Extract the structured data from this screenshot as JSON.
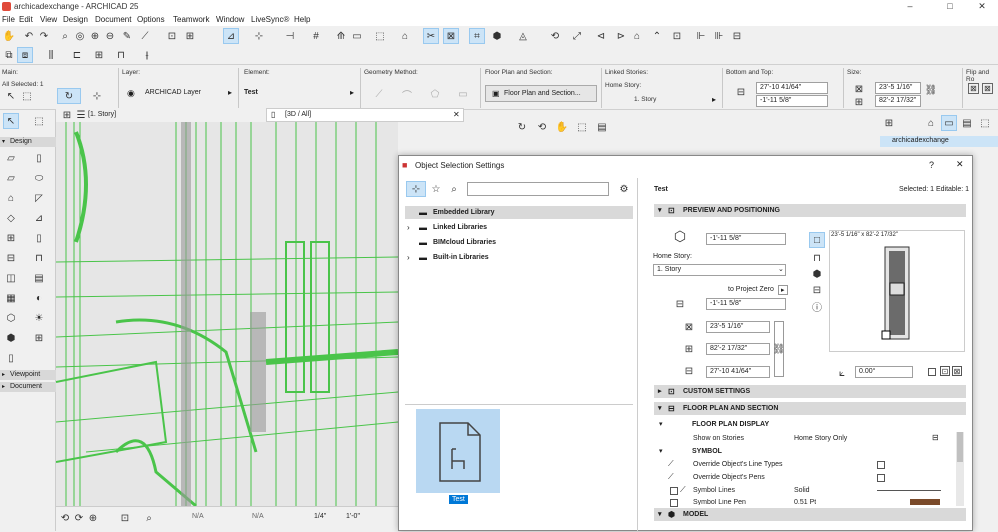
{
  "app": {
    "title": "archicadexchange - ARCHICAD 25"
  },
  "menu": [
    "File",
    "Edit",
    "View",
    "Design",
    "Document",
    "Options",
    "Teamwork",
    "Window",
    "LiveSync®",
    "Help"
  ],
  "info": {
    "main_label": "Main:",
    "selected": "All Selected: 1",
    "layer_label": "Layer:",
    "layer": "ARCHICAD Layer",
    "element_label": "Element:",
    "element": "Test",
    "geometry_label": "Geometry Method:",
    "fps_label": "Floor Plan and Section:",
    "fps": "Floor Plan and Section...",
    "linked_label": "Linked Stories:",
    "home_story_label": "Home Story:",
    "home_story": "1. Story",
    "bt_label": "Bottom and Top:",
    "bt_top": "27'-10 41/64\"",
    "bt_bottom": "-1'-11 5/8\"",
    "size_label": "Size:",
    "size_a": "23'-5 1/16\"",
    "size_b": "82'-2 17/32\"",
    "flip_label": "Flip and Ro"
  },
  "left": {
    "design": "Design",
    "viewpoint": "Viewpoint",
    "document": "Document"
  },
  "tabs": {
    "plan": "[1. Story]",
    "view3d": "[3D / All]"
  },
  "status": {
    "na1": "N/A",
    "na2": "N/A",
    "scale": "1/4\"",
    "dim": "1'-0\""
  },
  "right": {
    "name": "archicadexchange"
  },
  "dialog": {
    "title": "Object Selection Settings",
    "help": "?",
    "close": "✕",
    "tree": [
      {
        "label": "Embedded Library",
        "expand": ""
      },
      {
        "label": "Linked Libraries",
        "expand": "›"
      },
      {
        "label": "BIMcloud Libraries",
        "expand": ""
      },
      {
        "label": "Built-in Libraries",
        "expand": "›"
      }
    ],
    "preview_label": "Test",
    "name": "Test",
    "selected": "Selected: 1 Editable: 1",
    "sections": {
      "preview": "PREVIEW AND POSITIONING",
      "custom": "CUSTOM SETTINGS",
      "fps": "FLOOR PLAN AND SECTION",
      "model": "MODEL"
    },
    "pos": {
      "elev": "-1'-11 5/8\"",
      "home_story_label": "Home Story:",
      "home_story": "1. Story",
      "to_zero": "to Project Zero",
      "zero_elev": "-1'-11 5/8\"",
      "w": "23'-5 1/16\"",
      "d": "82'-2 17/32\"",
      "h": "27'-10 41/64\"",
      "angle": "0.00°",
      "preview_dims": "23'-5 1/16\" x 82'-2 17/32\""
    },
    "fp": {
      "header": "FLOOR PLAN DISPLAY",
      "show_label": "Show on Stories",
      "show_value": "Home Story Only",
      "symbol": "SYMBOL",
      "r1": "Override Object's Line Types",
      "r2": "Override Object's Pens",
      "r3": "Symbol Lines",
      "r3v": "Solid",
      "r4": "Symbol Line Pen",
      "r4v": "0.51 Pt"
    }
  },
  "colors": {
    "accent": "#0078d7",
    "wire": "#2fbf2f",
    "select_bg": "#cce4f7"
  }
}
